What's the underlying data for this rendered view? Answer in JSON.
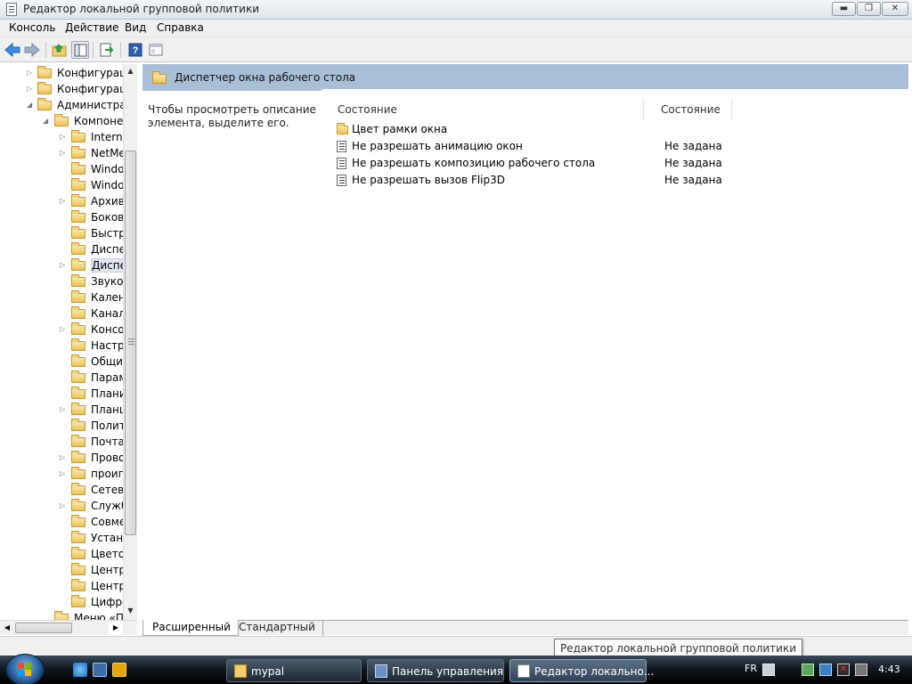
{
  "window": {
    "title": "Редактор локальной групповой политики",
    "min_glyph": "▬",
    "max_glyph": "❐",
    "close_glyph": "✕"
  },
  "menu": [
    "Консоль",
    "Действие",
    "Вид",
    "Справка"
  ],
  "tree": {
    "items": [
      {
        "label": "Конфигурация компьютера",
        "level": 1,
        "expander": "▷"
      },
      {
        "label": "Конфигурация пользователя",
        "level": 1,
        "expander": "▷"
      },
      {
        "label": "Административные шаблоны",
        "level": 1,
        "expander": "◢"
      },
      {
        "label": "Компоненты Windows",
        "level": 2,
        "expander": "◢"
      },
      {
        "label": "Internet Explorer",
        "level": 3,
        "expander": "▷"
      },
      {
        "label": "NetMeeting",
        "level": 3,
        "expander": "▷"
      },
      {
        "label": "Windows Mail",
        "level": 3,
        "expander": ""
      },
      {
        "label": "Windows Media Player",
        "level": 3,
        "expander": ""
      },
      {
        "label": "Архивация",
        "level": 3,
        "expander": "▷"
      },
      {
        "label": "Боковая панель",
        "level": 3,
        "expander": ""
      },
      {
        "label": "Быстрое переключение",
        "level": 3,
        "expander": ""
      },
      {
        "label": "Диспетчер задач",
        "level": 3,
        "expander": ""
      },
      {
        "label": "Диспетчер окна рабочего стола",
        "level": 3,
        "expander": "▷",
        "selected": true
      },
      {
        "label": "Звукозапись",
        "level": 3,
        "expander": ""
      },
      {
        "label": "Календарь Windows",
        "level": 3,
        "expander": ""
      },
      {
        "label": "Канал RSS",
        "level": 3,
        "expander": ""
      },
      {
        "label": "Консоль управления",
        "level": 3,
        "expander": "▷"
      },
      {
        "label": "Настройки презентации",
        "level": 3,
        "expander": ""
      },
      {
        "label": "Общий доступ",
        "level": 3,
        "expander": ""
      },
      {
        "label": "Параметры",
        "level": 3,
        "expander": ""
      },
      {
        "label": "Планировщик",
        "level": 3,
        "expander": ""
      },
      {
        "label": "Планшетный ПК",
        "level": 3,
        "expander": "▷"
      },
      {
        "label": "Политики",
        "level": 3,
        "expander": ""
      },
      {
        "label": "Почта",
        "level": 3,
        "expander": ""
      },
      {
        "label": "Проводник",
        "level": 3,
        "expander": "▷"
      },
      {
        "label": "проигрыватель",
        "level": 3,
        "expander": "▷"
      },
      {
        "label": "Сетевой проектор",
        "level": 3,
        "expander": ""
      },
      {
        "label": "Службы",
        "level": 3,
        "expander": "▷"
      },
      {
        "label": "Совместимость",
        "level": 3,
        "expander": ""
      },
      {
        "label": "Установщик",
        "level": 3,
        "expander": ""
      },
      {
        "label": "Цветовая схема",
        "level": 3,
        "expander": ""
      },
      {
        "label": "Центр обновления",
        "level": 3,
        "expander": ""
      },
      {
        "label": "Центр безопасности",
        "level": 3,
        "expander": ""
      },
      {
        "label": "Цифровой ящик",
        "level": 3,
        "expander": ""
      },
      {
        "label": "Меню «Пуск»",
        "level": 2,
        "expander": ""
      }
    ]
  },
  "details": {
    "header_title": "Диспетчер окна рабочего стола",
    "description": "Чтобы просмотреть описание элемента, выделите его.",
    "columns": [
      "Состояние",
      "Состояние"
    ],
    "rows": [
      {
        "name": "Цвет рамки окна",
        "state": "",
        "type": "folder"
      },
      {
        "name": "Не разрешать анимацию окон",
        "state": "Не задана",
        "type": "policy"
      },
      {
        "name": "Не разрешать композицию рабочего стола",
        "state": "Не задана",
        "type": "policy"
      },
      {
        "name": "Не разрешать вызов Flip3D",
        "state": "Не задана",
        "type": "policy"
      }
    ]
  },
  "tabs": [
    "Расширенный",
    "Стандартный"
  ],
  "tooltip": "Редактор локальной групповой политики",
  "taskbar": {
    "tasks": [
      {
        "label": "mypal",
        "active": false
      },
      {
        "label": "Панель управления",
        "active": false
      },
      {
        "label": "Редактор локально...",
        "active": true
      }
    ],
    "lang": "FR",
    "clock": "4:43"
  },
  "colors": {
    "header_band": "#a9bfd6",
    "taskbar": "#101820"
  }
}
